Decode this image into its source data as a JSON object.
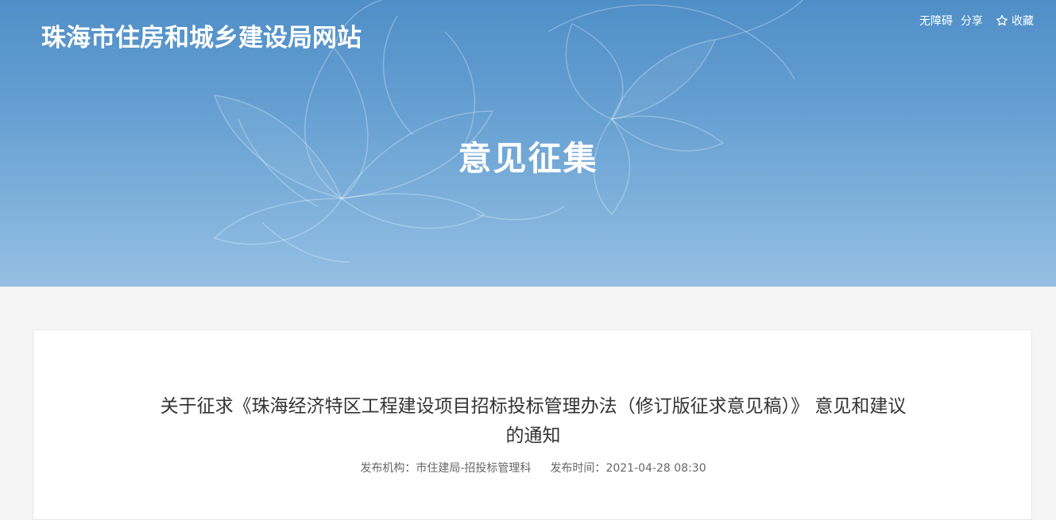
{
  "header": {
    "site_title": "珠海市住房和城乡建设局网站",
    "links": {
      "accessibility": "无障碍",
      "share": "分享",
      "favorite": "收藏"
    },
    "favorite_icon": "star-outline-icon"
  },
  "banner": {
    "section_title": "意见征集",
    "colors": {
      "top": "#4f8ec7",
      "bottom": "#95bfe3"
    }
  },
  "article": {
    "title_line1": "关于征求《珠海经济特区工程建设项目招标投标管理办法（修订版征求意见稿）》 意见和建议",
    "title_line2": "的通知",
    "publisher_label": "发布机构：",
    "publisher": "市住建局-招投标管理科",
    "time_label": "发布时间：",
    "time": "2021-04-28 08:30"
  }
}
